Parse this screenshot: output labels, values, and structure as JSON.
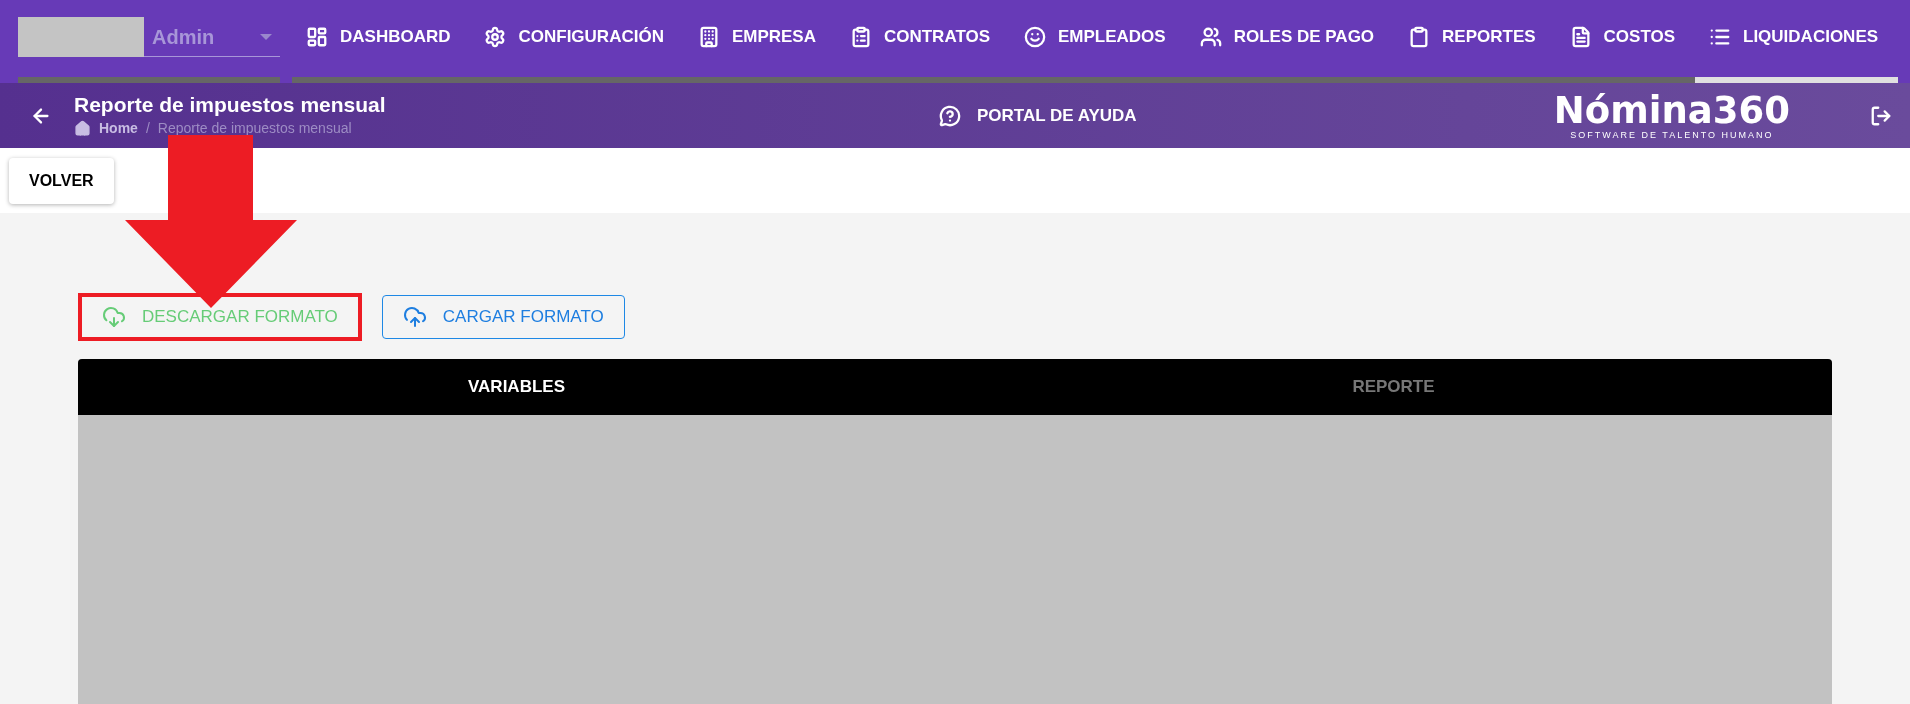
{
  "user": {
    "name": "Admin"
  },
  "nav_tabs": [
    {
      "label": "DASHBOARD",
      "selected": false
    },
    {
      "label": "CONFIGURACIÓN",
      "selected": false
    },
    {
      "label": "EMPRESA",
      "selected": false
    },
    {
      "label": "CONTRATOS",
      "selected": false
    },
    {
      "label": "EMPLEADOS",
      "selected": false
    },
    {
      "label": "ROLES DE PAGO",
      "selected": false
    },
    {
      "label": "REPORTES",
      "selected": false
    },
    {
      "label": "COSTOS",
      "selected": false
    },
    {
      "label": "LIQUIDACIONES",
      "selected": true
    }
  ],
  "page_header": {
    "title": "Reporte de impuestos mensual",
    "breadcrumb": [
      "Home",
      "/",
      "Reporte de impuestos mensual"
    ],
    "help_link": "PORTAL DE AYUDA",
    "logo": {
      "name": "Nómina360",
      "tagline": "SOFTWARE DE TALENTO HUMANO"
    }
  },
  "back_button": "VOLVER",
  "actions": [
    {
      "label": "DESCARGAR FORMATO",
      "kind": "download",
      "highlighted": true
    },
    {
      "label": "CARGAR FORMATO",
      "kind": "upload",
      "highlighted": false
    }
  ],
  "report_tabs": [
    {
      "label": "VARIABLES",
      "selected": true
    },
    {
      "label": "REPORTE",
      "selected": false
    }
  ]
}
